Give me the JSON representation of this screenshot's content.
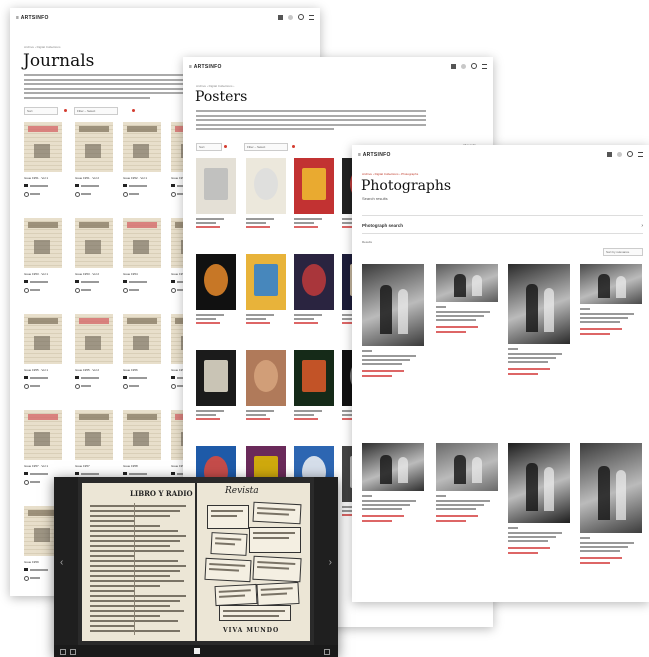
{
  "brand": "≡ ARTSINFO",
  "journals": {
    "breadcrumb": "Archive › Digital Collections",
    "title": "Journals",
    "filter_labels": [
      "Sort",
      "Filter – Select"
    ],
    "tiles": [
      {
        "caption": "Issue 1951 · Vol 1"
      },
      {
        "caption": "Issue 1951 · Vol 2"
      },
      {
        "caption": "Issue 1952 · Vol 1"
      },
      {
        "caption": "Issue 1952"
      },
      {
        "caption": "Issue 1953 · Vol 1"
      },
      {
        "caption": "Issue 1953 · Vol 2"
      },
      {
        "caption": "Issue 1954"
      },
      {
        "caption": "Issue 1954"
      },
      {
        "caption": "Issue 1955 · Vol 1"
      },
      {
        "caption": "Issue 1955 · Vol 2"
      },
      {
        "caption": "Issue 1956"
      },
      {
        "caption": "Issue 1956"
      },
      {
        "caption": "Issue 1957 · Vol 1"
      },
      {
        "caption": "Issue 1957"
      },
      {
        "caption": "Issue 1958"
      },
      {
        "caption": "Issue 1958"
      },
      {
        "caption": "Issue 1959"
      }
    ]
  },
  "posters": {
    "breadcrumb": "Archive › Digital Collections ›",
    "title": "Posters",
    "filter_labels": [
      "Sort",
      "Filter – Select"
    ],
    "results_label": "All results"
  },
  "photographs": {
    "breadcrumb": "Archive › Digital Collections › Photographs",
    "title": "Photographs",
    "subtitle": "Search results",
    "search_heading": "Photograph search",
    "results_label": "Results",
    "sort_label": "Sort by relevance"
  },
  "viewer": {
    "left_page_title": "LIBRO Y RADIO",
    "right_page_title": "Revista",
    "right_page_footer": "VIVA MUNDO"
  },
  "colors": {
    "accent": "#d43c30",
    "viewer_bg": "#2a2a2a"
  }
}
